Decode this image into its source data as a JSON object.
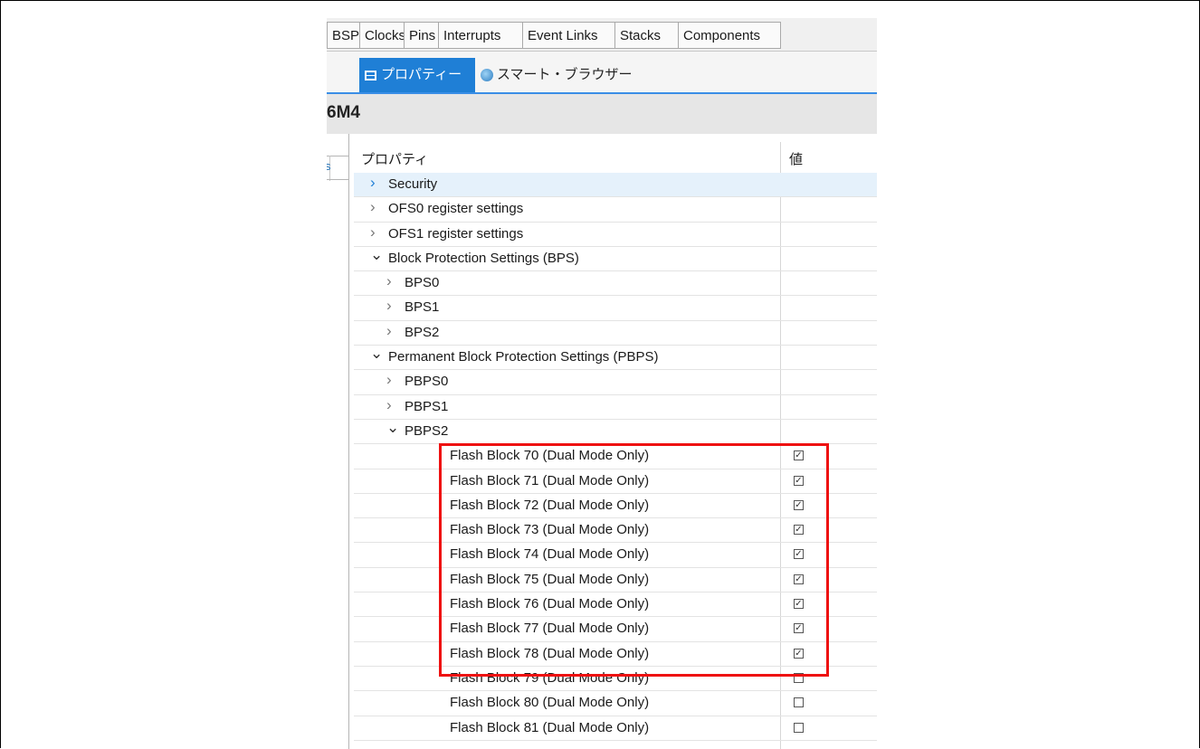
{
  "tabstrip": {
    "tabs": [
      "BSP",
      "Clocks",
      "Pins",
      "Interrupts",
      "Event Links",
      "Stacks",
      "Components"
    ]
  },
  "view_tabs": {
    "active": "プロパティー",
    "active_close": "✕",
    "other": "スマート・ブラウザー"
  },
  "title_fragment": "6M4",
  "left_fragment": "s",
  "table": {
    "col_property": "プロパティ",
    "col_value": "値",
    "rows": [
      {
        "label": "Security",
        "level": 0,
        "twisty": "collapsed",
        "selected": true
      },
      {
        "label": "OFS0 register settings",
        "level": 0,
        "twisty": "collapsed"
      },
      {
        "label": "OFS1 register settings",
        "level": 0,
        "twisty": "collapsed"
      },
      {
        "label": "Block Protection Settings (BPS)",
        "level": 0,
        "twisty": "expanded"
      },
      {
        "label": "BPS0",
        "level": 1,
        "twisty": "collapsed"
      },
      {
        "label": "BPS1",
        "level": 1,
        "twisty": "collapsed"
      },
      {
        "label": "BPS2",
        "level": 1,
        "twisty": "collapsed"
      },
      {
        "label": "Permanent Block Protection Settings (PBPS)",
        "level": 0,
        "twisty": "expanded"
      },
      {
        "label": "PBPS0",
        "level": 1,
        "twisty": "collapsed"
      },
      {
        "label": "PBPS1",
        "level": 1,
        "twisty": "collapsed"
      },
      {
        "label": "PBPS2",
        "level": 1,
        "twisty": "expanded"
      },
      {
        "label": "Flash Block 70 (Dual Mode Only)",
        "level": 2,
        "checked": true
      },
      {
        "label": "Flash Block 71 (Dual Mode Only)",
        "level": 2,
        "checked": true
      },
      {
        "label": "Flash Block 72 (Dual Mode Only)",
        "level": 2,
        "checked": true
      },
      {
        "label": "Flash Block 73 (Dual Mode Only)",
        "level": 2,
        "checked": true
      },
      {
        "label": "Flash Block 74 (Dual Mode Only)",
        "level": 2,
        "checked": true
      },
      {
        "label": "Flash Block 75 (Dual Mode Only)",
        "level": 2,
        "checked": true
      },
      {
        "label": "Flash Block 76 (Dual Mode Only)",
        "level": 2,
        "checked": true
      },
      {
        "label": "Flash Block 77 (Dual Mode Only)",
        "level": 2,
        "checked": true
      },
      {
        "label": "Flash Block 78 (Dual Mode Only)",
        "level": 2,
        "checked": true
      },
      {
        "label": "Flash Block 79 (Dual Mode Only)",
        "level": 2,
        "checked": false
      },
      {
        "label": "Flash Block 80 (Dual Mode Only)",
        "level": 2,
        "checked": false
      },
      {
        "label": "Flash Block 81 (Dual Mode Only)",
        "level": 2,
        "checked": false
      }
    ]
  },
  "colors": {
    "accent": "#1f7fd6",
    "highlight_box": "#ee1111",
    "selected_row": "#e5f1fb"
  },
  "icons": {
    "expanded": "chevron-down-icon",
    "collapsed": "chevron-right-icon",
    "properties": "properties-icon",
    "browser": "globe-icon"
  }
}
